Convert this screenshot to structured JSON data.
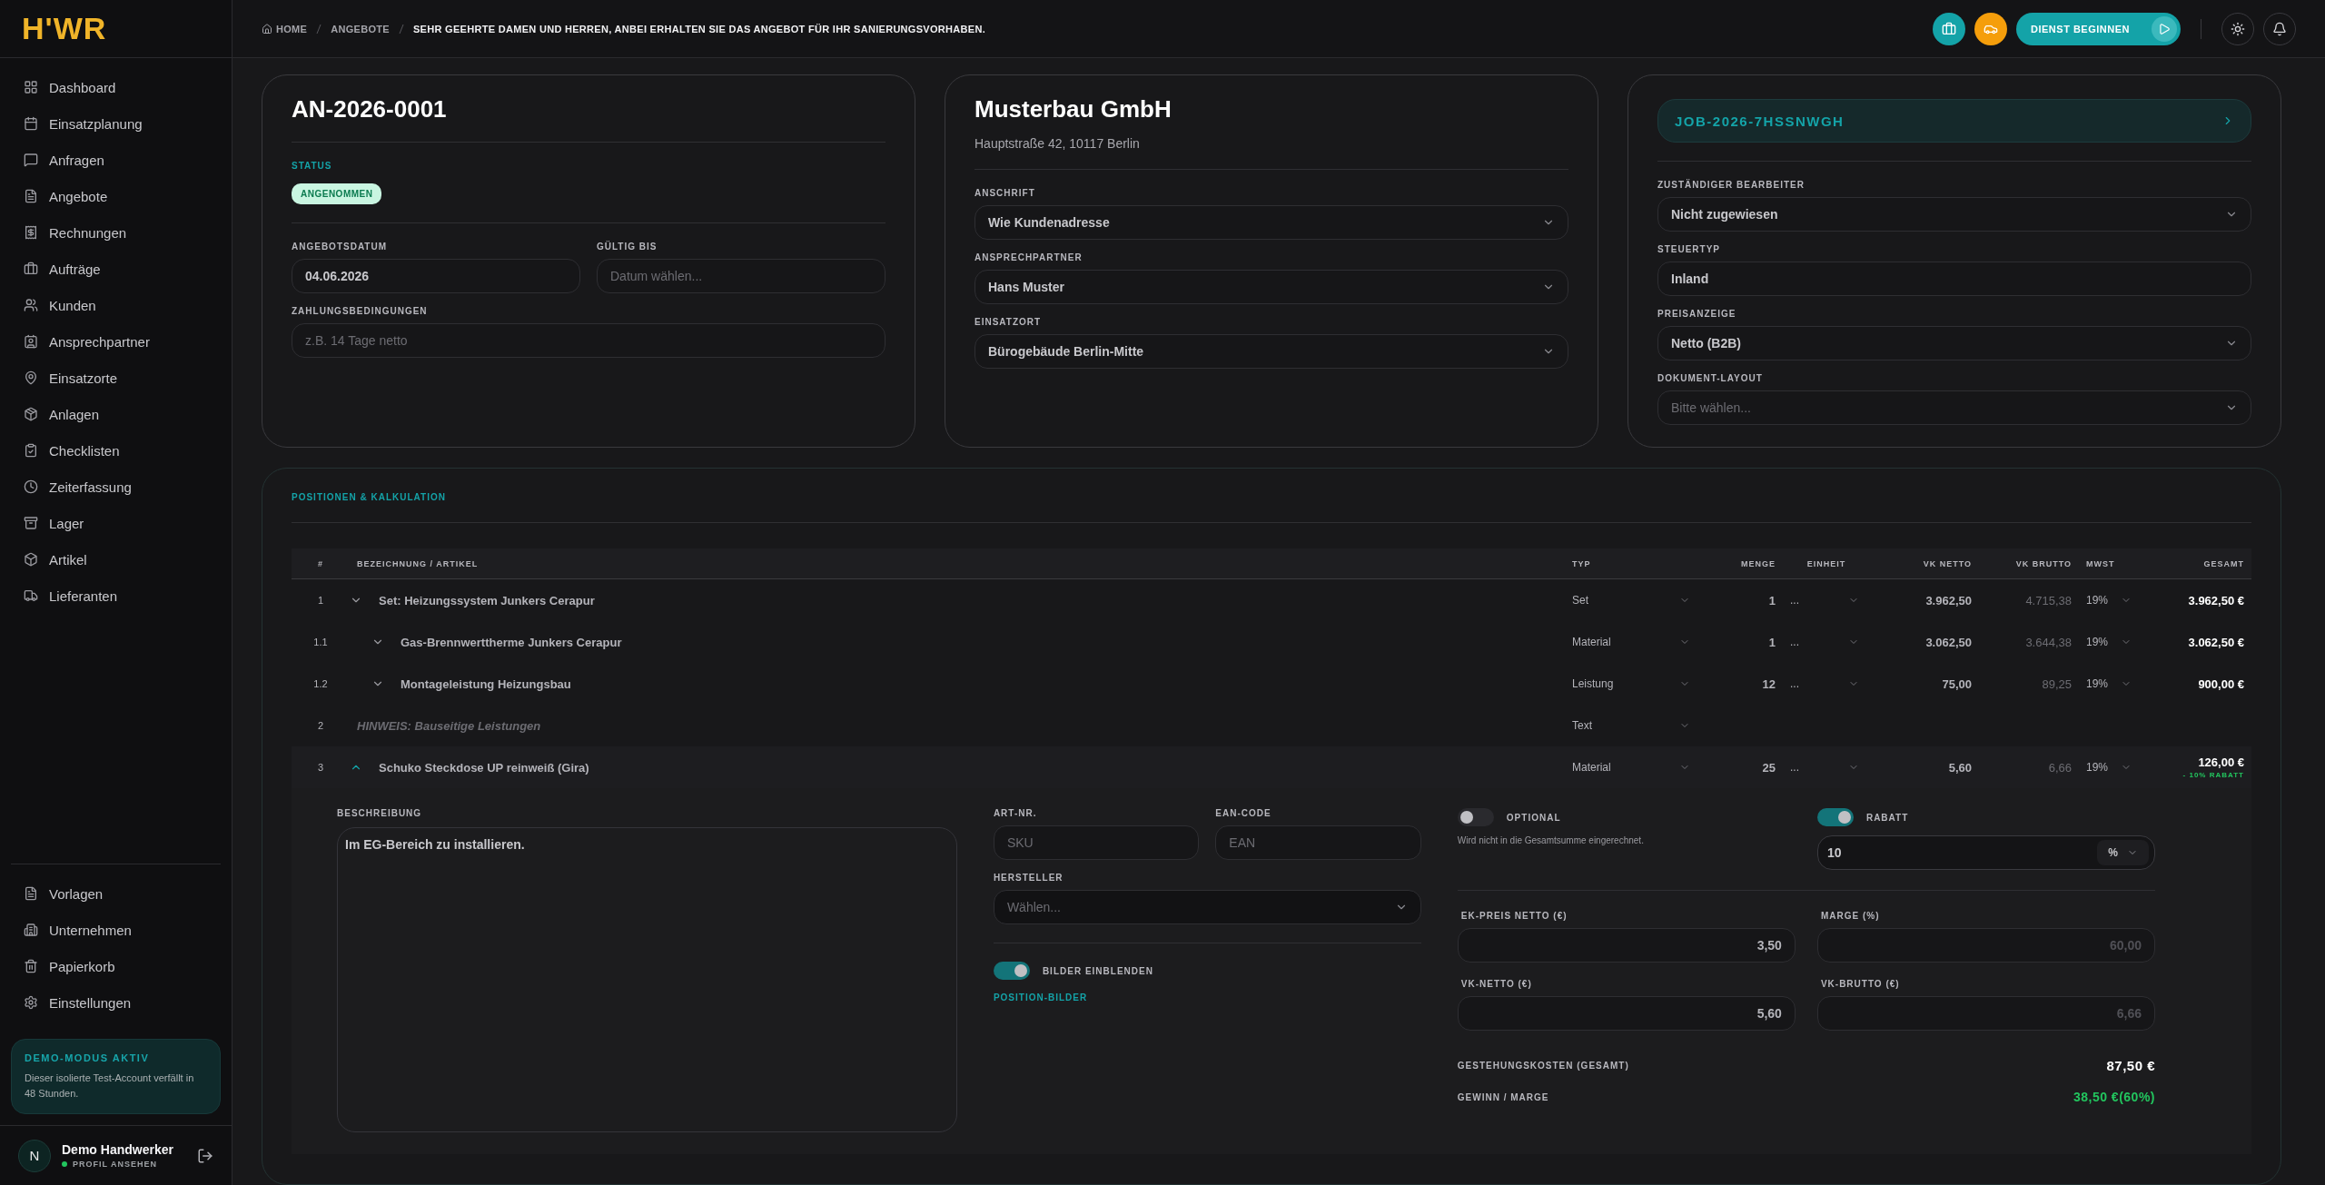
{
  "brand": {
    "logo": "H'WR"
  },
  "sidebar": {
    "items": [
      {
        "label": "Dashboard",
        "selected": false
      },
      {
        "label": "Einsatzplanung",
        "selected": false
      },
      {
        "label": "Anfragen",
        "selected": false
      },
      {
        "label": "Angebote",
        "selected": false
      },
      {
        "label": "Rechnungen",
        "selected": false
      },
      {
        "label": "Aufträge",
        "selected": false
      },
      {
        "label": "Kunden",
        "selected": false
      },
      {
        "label": "Ansprechpartner",
        "selected": false
      },
      {
        "label": "Einsatzorte",
        "selected": false
      },
      {
        "label": "Anlagen",
        "selected": false
      },
      {
        "label": "Checklisten",
        "selected": false
      },
      {
        "label": "Zeiterfassung",
        "selected": false
      },
      {
        "label": "Lager",
        "selected": false
      },
      {
        "label": "Artikel",
        "selected": false
      },
      {
        "label": "Lieferanten",
        "selected": false
      }
    ],
    "bottom_items": [
      {
        "label": "Vorlagen",
        "selected": false
      },
      {
        "label": "Unternehmen",
        "selected": false
      },
      {
        "label": "Papierkorb",
        "selected": false
      },
      {
        "label": "Einstellungen",
        "selected": false
      }
    ],
    "demo": {
      "title": "DEMO-MODUS AKTIV",
      "text": "Dieser isolierte Test-Account verfällt in 48 Stunden."
    },
    "user": {
      "initial": "N",
      "name": "Demo Handwerker",
      "link": "PROFIL ANSEHEN"
    }
  },
  "header": {
    "breadcrumb": [
      "HOME",
      "ANGEBOTE",
      "SEHR GEEHRTE DAMEN UND HERREN, ANBEI ERHALTEN SIE DAS ANGEBOT FÜR IHR SANIERUNGSVORHABEN."
    ],
    "start_button": "DIENST BEGINNEN"
  },
  "offer_card": {
    "number": "AN-2026-0001",
    "status_label": "STATUS",
    "status": "ANGENOMMEN",
    "fields": [
      {
        "label": "ANGEBOTSDATUM",
        "value": "04.06.2026"
      },
      {
        "label": "GÜLTIG BIS",
        "placeholder": "Datum wählen..."
      },
      {
        "label": "ZAHLUNGSBEDINGUNGEN",
        "placeholder": "z.B. 14 Tage netto"
      }
    ]
  },
  "customer_card": {
    "name": "Musterbau GmbH",
    "address": "Hauptstraße 42, 10117 Berlin",
    "fields": [
      {
        "label": "ANSCHRIFT",
        "value": "Wie Kundenadresse"
      },
      {
        "label": "ANSPRECHPARTNER",
        "value": "Hans Muster"
      },
      {
        "label": "EINSATZORT",
        "value": "Bürogebäude Berlin-Mitte"
      }
    ]
  },
  "job_card": {
    "job": "JOB-2026-7HSSNWGH",
    "fields": [
      {
        "label": "ZUSTÄNDIGER BEARBEITER",
        "value": "Nicht zugewiesen",
        "kind": "select"
      },
      {
        "label": "STEUERTYP",
        "value": "Inland",
        "kind": "input"
      },
      {
        "label": "PREISANZEIGE",
        "value": "Netto (B2B)",
        "kind": "select"
      },
      {
        "label": "DOKUMENT-LAYOUT",
        "placeholder": "Bitte wählen...",
        "kind": "select"
      }
    ]
  },
  "positions": {
    "title": "POSITIONEN & KALKULATION",
    "columns": [
      "#",
      "BEZEICHNUNG / ARTIKEL",
      "TYP",
      "MENGE",
      "EINHEIT",
      "VK NETTO",
      "VK BRUTTO",
      "MWST",
      "GESAMT"
    ],
    "rows": [
      {
        "kind": "item",
        "num": "1",
        "name": "Set: Heizungssystem Junkers Cerapur",
        "type": "Set",
        "qty": "1",
        "unit": "...",
        "vk_netto": "3.962,50",
        "vk_brutto": "4.715,38",
        "tax": "19%",
        "total": "3.962,50 €",
        "expanded": false,
        "children": [
          {
            "kind": "item",
            "num": "1.1",
            "name": "Gas-Brennwerttherme Junkers Cerapur",
            "type": "Material",
            "qty": "1",
            "unit": "...",
            "vk_netto": "3.062,50",
            "vk_brutto": "3.644,38",
            "tax": "19%",
            "total": "3.062,50 €",
            "expanded": false
          },
          {
            "kind": "item",
            "num": "1.2",
            "name": "Montageleistung Heizungsbau",
            "type": "Leistung",
            "qty": "12",
            "unit": "...",
            "vk_netto": "75,00",
            "vk_brutto": "89,25",
            "tax": "19%",
            "total": "900,00 €",
            "expanded": false
          }
        ]
      },
      {
        "kind": "note",
        "num": "2",
        "name": "HINWEIS: Bauseitige Leistungen",
        "type": "Text"
      },
      {
        "kind": "item",
        "num": "3",
        "name": "Schuko Steckdose UP reinweiß (Gira)",
        "type": "Material",
        "qty": "25",
        "unit": "...",
        "vk_netto": "5,60",
        "vk_brutto": "6,66",
        "tax": "19%",
        "total": "126,00 €",
        "discount": "- 10% RABATT",
        "expanded": true
      }
    ],
    "detail": {
      "description_label": "BESCHREIBUNG",
      "description": "Im EG-Bereich zu installieren.",
      "art_nr": {
        "label": "ART-NR.",
        "placeholder": "SKU"
      },
      "ean": {
        "label": "EAN-CODE",
        "placeholder": "EAN"
      },
      "manufacturer": {
        "label": "HERSTELLER",
        "placeholder": "Wählen..."
      },
      "images_toggle": {
        "label": "BILDER EINBLENDEN",
        "on": true
      },
      "images_link": "POSITION-BILDER",
      "optional": {
        "label": "OPTIONAL",
        "on": false,
        "hint": "Wird nicht in die Gesamtsumme eingerechnet."
      },
      "discount": {
        "label": "RABATT",
        "on": true,
        "value": "10",
        "unit": "%"
      },
      "prices": [
        {
          "label": "EK-PREIS NETTO (€)",
          "value": "3,50",
          "disabled": false
        },
        {
          "label": "MARGE (%)",
          "value": "60,00",
          "disabled": true
        },
        {
          "label": "VK-NETTO (€)",
          "value": "5,60",
          "disabled": false
        },
        {
          "label": "VK-BRUTTO (€)",
          "value": "6,66",
          "disabled": true
        }
      ],
      "summary": [
        {
          "label": "GESTEHUNGSKOSTEN (GESAMT)",
          "value": "87,50 €",
          "kind": "cost"
        },
        {
          "label": "GEWINN / MARGE",
          "value": "38,50 €(60%)",
          "kind": "profit"
        }
      ]
    }
  }
}
